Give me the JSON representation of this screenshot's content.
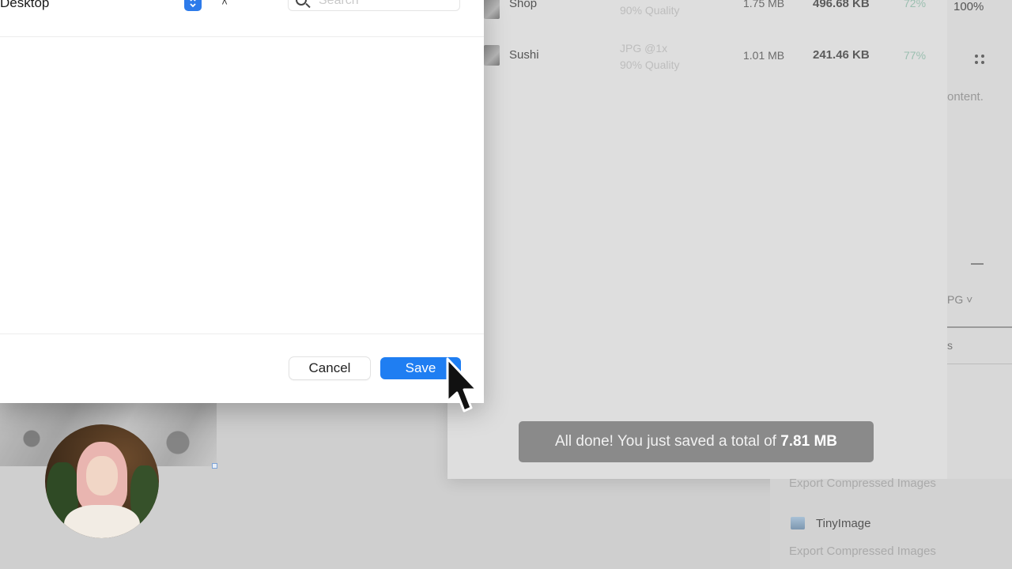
{
  "background_app": {
    "rows": [
      {
        "name": "Shop",
        "format": "",
        "quality": "90% Quality",
        "original_size": "1.75 MB",
        "compressed_size": "496.68 KB",
        "savings": "72%"
      },
      {
        "name": "Sushi",
        "format": "JPG @1x",
        "quality": "90% Quality",
        "original_size": "1.01 MB",
        "compressed_size": "241.46 KB",
        "savings": "77%"
      }
    ],
    "toast": {
      "prefix": "All done! You just saved a total of ",
      "amount": "7.81 MB"
    }
  },
  "right_panel": {
    "zoom": "100%",
    "grid_icon": "grid-icon",
    "text_fragment": "ontent.",
    "format_fragment": "PG ˅",
    "s_fragment": "s"
  },
  "lower_list": {
    "export_label_1": "Export Compressed Images",
    "app_name": "TinyImage",
    "export_label_2": "Export Compressed Images"
  },
  "save_dialog": {
    "where_value": "Desktop",
    "chevron_icon": "chevron-up-down-icon",
    "expand_glyph": "˄",
    "search_placeholder": "Search",
    "cancel_label": "Cancel",
    "save_label": "Save"
  },
  "colors": {
    "accent_blue": "#1f7ef2",
    "toast_bg": "#8a8a8a",
    "dim_overlay": "#cfcfcf"
  }
}
